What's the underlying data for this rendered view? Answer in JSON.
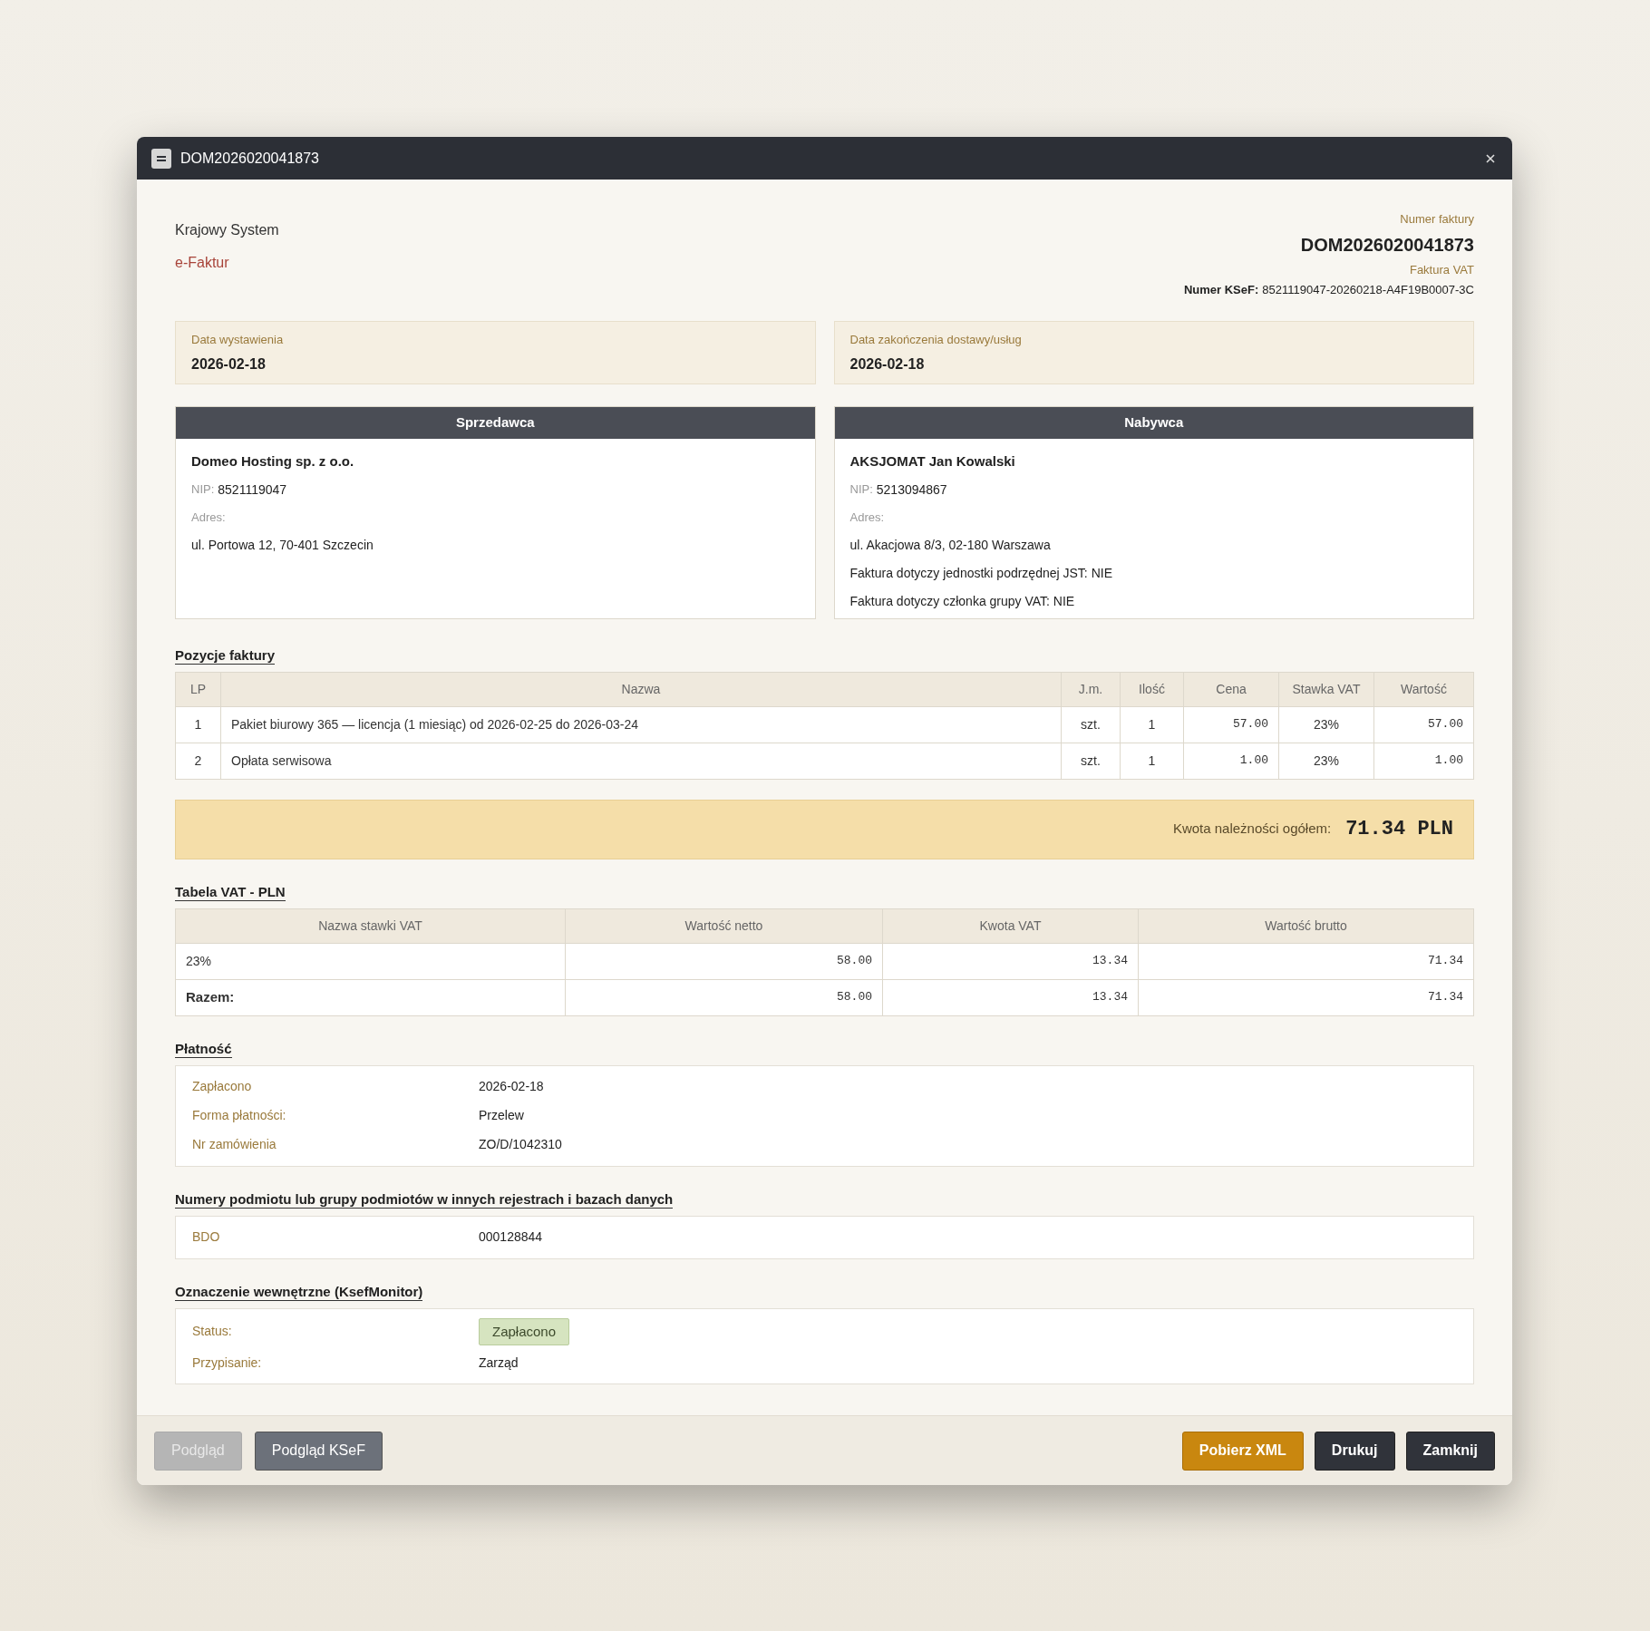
{
  "window": {
    "title": "DOM2026020041873"
  },
  "header": {
    "system_line1": "Krajowy System",
    "system_line2": "e-Faktur",
    "number_label": "Numer faktury",
    "number": "DOM2026020041873",
    "type": "Faktura VAT",
    "ksef_label": "Numer KSeF:",
    "ksef_value": "8521119047-20260218-A4F19B0007-3C"
  },
  "dates": [
    {
      "label": "Data wystawienia",
      "value": "2026-02-18"
    },
    {
      "label": "Data zakończenia dostawy/usług",
      "value": "2026-02-18"
    }
  ],
  "parties": [
    {
      "title": "Sprzedawca",
      "name": "Domeo Hosting sp. z o.o.",
      "nip_label": "NIP:",
      "nip": "8521119047",
      "address_label": "Adres:",
      "lines": [
        "ul. Portowa 12, 70-401 Szczecin"
      ]
    },
    {
      "title": "Nabywca",
      "name": "AKSJOMAT Jan Kowalski",
      "nip_label": "NIP:",
      "nip": "5213094867",
      "address_label": "Adres:",
      "lines": [
        "ul. Akacjowa 8/3, 02-180 Warszawa",
        "Faktura dotyczy jednostki podrzędnej JST: NIE",
        "Faktura dotyczy członka grupy VAT: NIE"
      ]
    }
  ],
  "items": {
    "title": "Pozycje faktury",
    "columns": [
      "LP",
      "Nazwa",
      "J.m.",
      "Ilość",
      "Cena",
      "Stawka VAT",
      "Wartość"
    ],
    "rows": [
      [
        "1",
        "Pakiet biurowy 365 — licencja (1 miesiąc) od 2026-02-25 do 2026-03-24",
        "szt.",
        "1",
        "57.00",
        "23%",
        "57.00"
      ],
      [
        "2",
        "Opłata serwisowa",
        "szt.",
        "1",
        "1.00",
        "23%",
        "1.00"
      ]
    ]
  },
  "total": {
    "label": "Kwota należności ogółem:",
    "value": "71.34 PLN"
  },
  "vat_table": {
    "title": "Tabela VAT - PLN",
    "columns": [
      "Nazwa stawki VAT",
      "Wartość netto",
      "Kwota VAT",
      "Wartość brutto"
    ],
    "rows": [
      {
        "kind": "rate",
        "cells": [
          "23%",
          "58.00",
          "13.34",
          "71.34"
        ]
      },
      {
        "kind": "sum",
        "cells": [
          "Razem:",
          "58.00",
          "13.34",
          "71.34"
        ]
      }
    ]
  },
  "payment": {
    "title": "Płatność",
    "rows": [
      {
        "label": "Zapłacono",
        "value": "2026-02-18"
      },
      {
        "label": "Forma płatności:",
        "value": "Przelew"
      },
      {
        "label": "Nr zamówienia",
        "value": "ZO/D/1042310"
      }
    ]
  },
  "registries": {
    "title": "Numery podmiotu lub grupy podmiotów w innych rejestrach i bazach danych",
    "rows": [
      {
        "label": "BDO",
        "value": "000128844"
      }
    ]
  },
  "internal": {
    "title": "Oznaczenie wewnętrzne (KsefMonitor)",
    "rows": [
      {
        "kind": "badge",
        "label": "Status:",
        "value": "Zapłacono",
        "color": "#d6e4c0"
      },
      {
        "kind": "text",
        "label": "Przypisanie:",
        "value": "Zarząd"
      }
    ]
  },
  "footer": {
    "left_buttons": [
      {
        "label": "Podgląd",
        "disabled": true
      },
      {
        "label": "Podgląd KSeF",
        "disabled": false
      }
    ],
    "right_buttons": [
      {
        "label": "Pobierz XML",
        "kind": "primary"
      },
      {
        "label": "Drukuj",
        "kind": "dark"
      },
      {
        "label": "Zamknij",
        "kind": "dark"
      }
    ]
  }
}
